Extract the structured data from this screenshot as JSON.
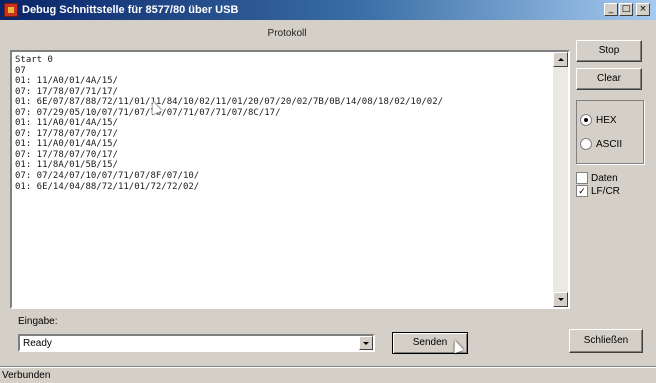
{
  "window": {
    "title": "Debug Schnittstelle für 8577/80 über USB"
  },
  "caption_buttons": {
    "minimize": "_",
    "maximize": "□",
    "close": "×"
  },
  "log": {
    "header": "Protokoll",
    "lines": [
      "Start 0",
      "07",
      "01: 11/A0/01/4A/15/",
      "07: 17/78/07/71/17/",
      "01: 6E/07/87/88/72/11/01/11/84/10/02/11/01/20/07/20/02/7B/0B/14/08/18/02/10/02/",
      "07: 07/29/05/10/07/71/07/70/07/71/07/71/07/8C/17/",
      "01: 11/A0/01/4A/15/",
      "07: 17/78/07/70/17/",
      "01: 11/A0/01/4A/15/",
      "07: 17/78/07/70/17/",
      "01: 11/8A/01/5B/15/",
      "07: 07/24/07/10/07/71/07/8F/07/10/",
      "01: 6E/14/04/88/72/11/01/72/72/02/"
    ]
  },
  "buttons": {
    "top1": "Stop",
    "top2": "Clear",
    "send": "Senden",
    "close": "Schließen"
  },
  "format": {
    "options": [
      "HEX",
      "ASCII"
    ],
    "selected": "HEX"
  },
  "checkboxes": [
    {
      "label": "Daten",
      "checked": false
    },
    {
      "label": "LF/CR",
      "checked": true
    }
  ],
  "input": {
    "label": "Eingabe:",
    "value": "Ready"
  },
  "status": {
    "text": "Verbunden"
  }
}
